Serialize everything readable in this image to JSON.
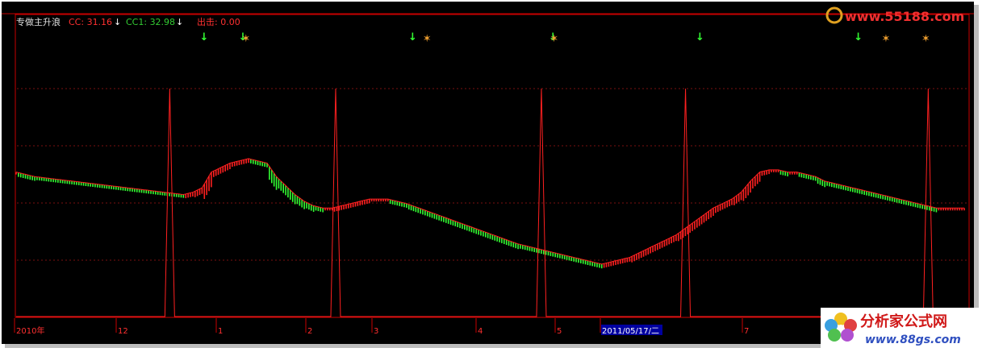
{
  "indicator": {
    "name": "专做主升浪",
    "cc_label": "CC: 31.16",
    "cc1_label": "CC1: 32.98",
    "out_label": "出击: 0.00"
  },
  "watermark_top": "www.55188.com",
  "watermark_bottom": {
    "title": "分析家公式网",
    "url": "www.88gs.com"
  },
  "colors": {
    "background": "#000000",
    "frame": "#c80000",
    "red": "#ff2020",
    "green": "#33ff33",
    "cc1_text": "#33cc33",
    "signal_orange": "#f0a030",
    "date_highlight": "#0000a0"
  },
  "x_axis": {
    "labels": [
      "2010年",
      "12",
      "1",
      "2",
      "3",
      "4",
      "5",
      "2011/05/17/二",
      "7"
    ],
    "highlight": "2011/05/17/二"
  },
  "chart_data": {
    "type": "line",
    "title": "",
    "xlabel": "",
    "ylabel": "",
    "grid": true,
    "series": [
      {
        "name": "CC",
        "note_color": "red/green by direction",
        "x_index": [
          0,
          8,
          16,
          24,
          32,
          40,
          48,
          56,
          64,
          72,
          76,
          80,
          84,
          88,
          92,
          96,
          100,
          104,
          108,
          112,
          116,
          120,
          124,
          128,
          132,
          136,
          140,
          144,
          148,
          152,
          156,
          160,
          168,
          176,
          184,
          192,
          200,
          208,
          216,
          224,
          232,
          240,
          244,
          248,
          252,
          256,
          260,
          264,
          268,
          272,
          276,
          280,
          284,
          288,
          292,
          296,
          300,
          304,
          308,
          312,
          316,
          320,
          324,
          328,
          332,
          336,
          340,
          344,
          348,
          352,
          356,
          360,
          364,
          368,
          372,
          376,
          380,
          384,
          388,
          392,
          396,
          400,
          404,
          408
        ],
        "values": [
          31.2,
          31.0,
          30.9,
          30.8,
          30.7,
          30.6,
          30.5,
          30.4,
          30.3,
          30.2,
          30.3,
          30.5,
          31.2,
          31.4,
          31.6,
          31.7,
          31.8,
          31.7,
          31.6,
          31.0,
          30.6,
          30.2,
          29.9,
          29.7,
          29.6,
          29.6,
          29.7,
          29.8,
          29.9,
          30.0,
          30.0,
          30.0,
          29.8,
          29.5,
          29.2,
          28.9,
          28.6,
          28.3,
          28.0,
          27.8,
          27.6,
          27.4,
          27.3,
          27.2,
          27.1,
          27.2,
          27.3,
          27.4,
          27.6,
          27.8,
          28.0,
          28.2,
          28.4,
          28.7,
          29.0,
          29.3,
          29.6,
          29.8,
          30.0,
          30.3,
          30.8,
          31.2,
          31.3,
          31.3,
          31.2,
          31.2,
          31.1,
          31.0,
          30.8,
          30.7,
          30.6,
          30.5,
          30.4,
          30.3,
          30.2,
          30.1,
          30.0,
          29.9,
          29.8,
          29.7,
          29.6,
          29.6,
          29.6,
          29.6
        ]
      },
      {
        "name": "出击",
        "type": "spike",
        "spikes_at_fraction": [
          0.162,
          0.337,
          0.554,
          0.706,
          0.962
        ]
      }
    ],
    "signals": {
      "down_arrows_fraction": [
        0.197,
        0.238,
        0.417,
        0.565,
        0.72,
        0.887
      ],
      "runners_fraction": [
        0.242,
        0.433,
        0.567,
        0.917,
        0.959
      ]
    }
  }
}
